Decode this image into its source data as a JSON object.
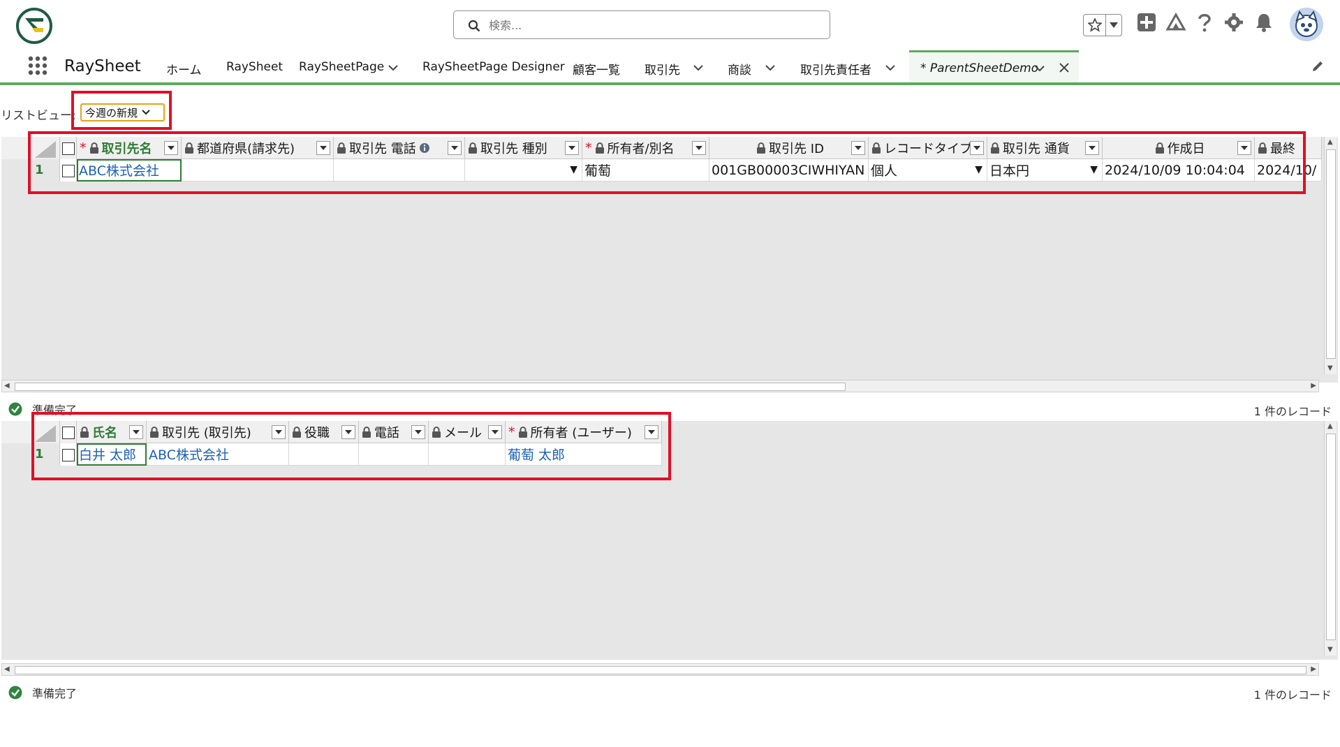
{
  "header": {
    "search_placeholder": "検索..."
  },
  "nav": {
    "app_name": "RaySheet",
    "items": [
      {
        "label": "ホーム",
        "has_menu": false
      },
      {
        "label": "RaySheet",
        "has_menu": false
      },
      {
        "label": "RaySheetPage",
        "has_menu": true
      },
      {
        "label": "RaySheetPage Designer",
        "has_menu": false
      },
      {
        "label": "顧客一覧",
        "has_menu": false
      },
      {
        "label": "取引先",
        "has_menu": true
      },
      {
        "label": "商談",
        "has_menu": true
      },
      {
        "label": "取引先責任者",
        "has_menu": true
      }
    ],
    "active_tab": "* ParentSheetDemo"
  },
  "list_view": {
    "label": "リストビュー:",
    "selected": "今週の新規"
  },
  "grid1": {
    "columns": [
      {
        "label": "取引先名",
        "required": true,
        "key": true
      },
      {
        "label": "都道府県(請求先)",
        "required": false
      },
      {
        "label": "取引先 電話",
        "required": false,
        "info": true
      },
      {
        "label": "取引先 種別",
        "required": false
      },
      {
        "label": "所有者/別名",
        "required": true
      },
      {
        "label": "取引先 ID",
        "required": false
      },
      {
        "label": "レコードタイプ",
        "required": false
      },
      {
        "label": "取引先 通貨",
        "required": false
      },
      {
        "label": "作成日",
        "required": false
      },
      {
        "label": "最終",
        "required": false
      }
    ],
    "rows": [
      {
        "num": "1",
        "cells": [
          "ABC株式会社",
          "",
          "",
          "",
          "葡萄",
          "001GB00003CIWHIYAN",
          "個人",
          "日本円",
          "2024/10/09 10:04:04",
          "2024/10/"
        ]
      }
    ],
    "status": "準備完了",
    "record_count": "1 件のレコード"
  },
  "grid2": {
    "columns": [
      {
        "label": "氏名",
        "required": false,
        "key": true
      },
      {
        "label": "取引先 (取引先)",
        "required": false
      },
      {
        "label": "役職",
        "required": false
      },
      {
        "label": "電話",
        "required": false
      },
      {
        "label": "メール",
        "required": false
      },
      {
        "label": "所有者 (ユーザー)",
        "required": true
      }
    ],
    "rows": [
      {
        "num": "1",
        "cells": [
          "白井 太郎",
          "ABC株式会社",
          "",
          "",
          "",
          "葡萄 太郎"
        ]
      }
    ],
    "status": "準備完了",
    "record_count": "1 件のレコード"
  },
  "colors": {
    "accent_green": "#2e7d32",
    "nav_green": "#5ea85e",
    "annotation_red": "#e00f27",
    "link_blue": "#1b5fb4"
  }
}
